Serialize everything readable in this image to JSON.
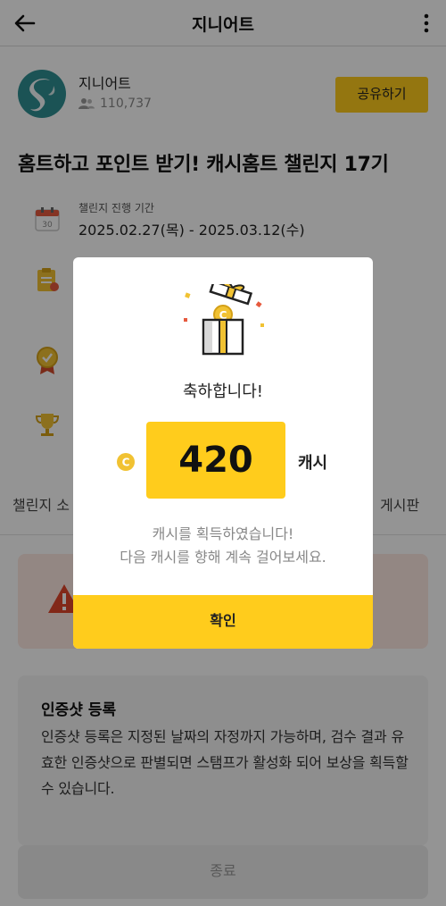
{
  "appbar": {
    "title": "지니어트"
  },
  "channel": {
    "name": "지니어트",
    "members": "110,737",
    "share_label": "공유하기"
  },
  "challenge": {
    "title": "홈트하고 포인트 받기! 캐시홈트 챌린지 17기",
    "period_label": "챌린지 진행 기간",
    "period_value": "2025.02.27(목) - 2025.03.12(수)"
  },
  "tabs": {
    "left": "챌린지 소",
    "right": "게시판"
  },
  "cert": {
    "title": "인증샷 등록",
    "body": "인증샷 등록은 지정된 날짜의 자정까지 가능하며, 검수 결과 유효한 인증샷으로 판별되면 스탬프가 활성화 되어 보상을 획득할 수 있습니다."
  },
  "end_label": "종료",
  "modal": {
    "congrats": "축하합니다!",
    "amount": "420",
    "unit": "캐시",
    "message_line1": "캐시를 획득하였습니다!",
    "message_line2": "다음 캐시를 향해 계속 걸어보세요.",
    "confirm_label": "확인"
  },
  "colors": {
    "accent": "#ffcc1c",
    "logo": "#2f8f93",
    "warning_bg": "#fde8e2",
    "warning_icon": "#e0452a"
  }
}
